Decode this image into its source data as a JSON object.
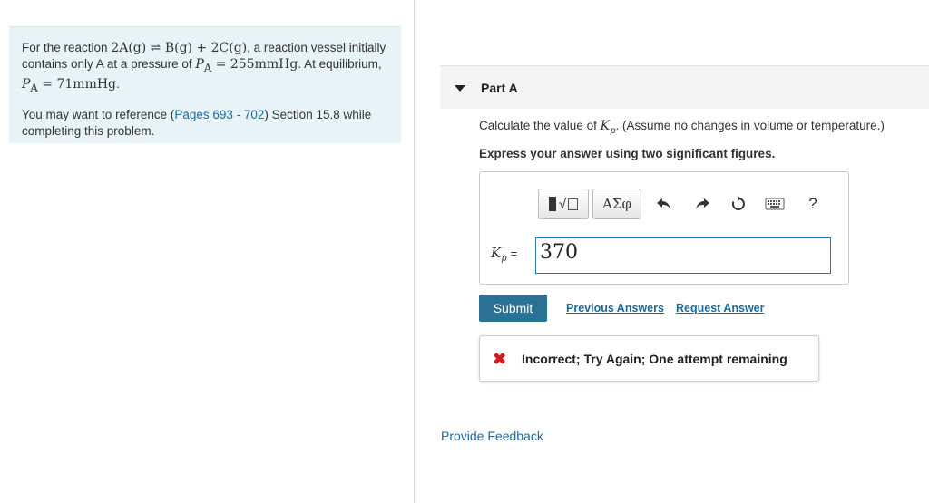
{
  "problem": {
    "intro_prefix": "For the reaction",
    "reaction": "2A(g) ⇌ B(g) + 2C(g)",
    "intro_mid": ", a reaction vessel initially contains only A at a pressure of",
    "pa_initial_label": "P",
    "pa_initial_sub": "A",
    "pa_initial_value": "= 255mmHg",
    "intro_end": ". At equilibrium,",
    "pa_eq_label": "P",
    "pa_eq_sub": "A",
    "pa_eq_value": "= 71mmHg",
    "ref_prefix": "You may want to reference (",
    "ref_link": "Pages 693 - 702",
    "ref_suffix": ") Section 15.8 while completing this problem."
  },
  "part": {
    "title": "Part A",
    "question_prefix": "Calculate the value of",
    "question_var": "K",
    "question_var_sub": "p",
    "question_suffix": ". (Assume no changes in volume or temperature.)",
    "instruction": "Express your answer using two significant figures."
  },
  "toolbar": {
    "greek_label": "ΑΣφ",
    "help_label": "?"
  },
  "answer": {
    "var": "K",
    "var_sub": "p",
    "eq": "=",
    "value": "370"
  },
  "actions": {
    "submit": "Submit",
    "previous_answers": "Previous Answers",
    "request_answer": "Request Answer"
  },
  "feedback": {
    "message": "Incorrect; Try Again; One attempt remaining"
  },
  "footer": {
    "provide_feedback": "Provide Feedback"
  },
  "colors": {
    "accent": "#2b7196",
    "link": "#1a6aa0",
    "error": "#d11c1c",
    "problem_bg": "#e8f3f7"
  }
}
